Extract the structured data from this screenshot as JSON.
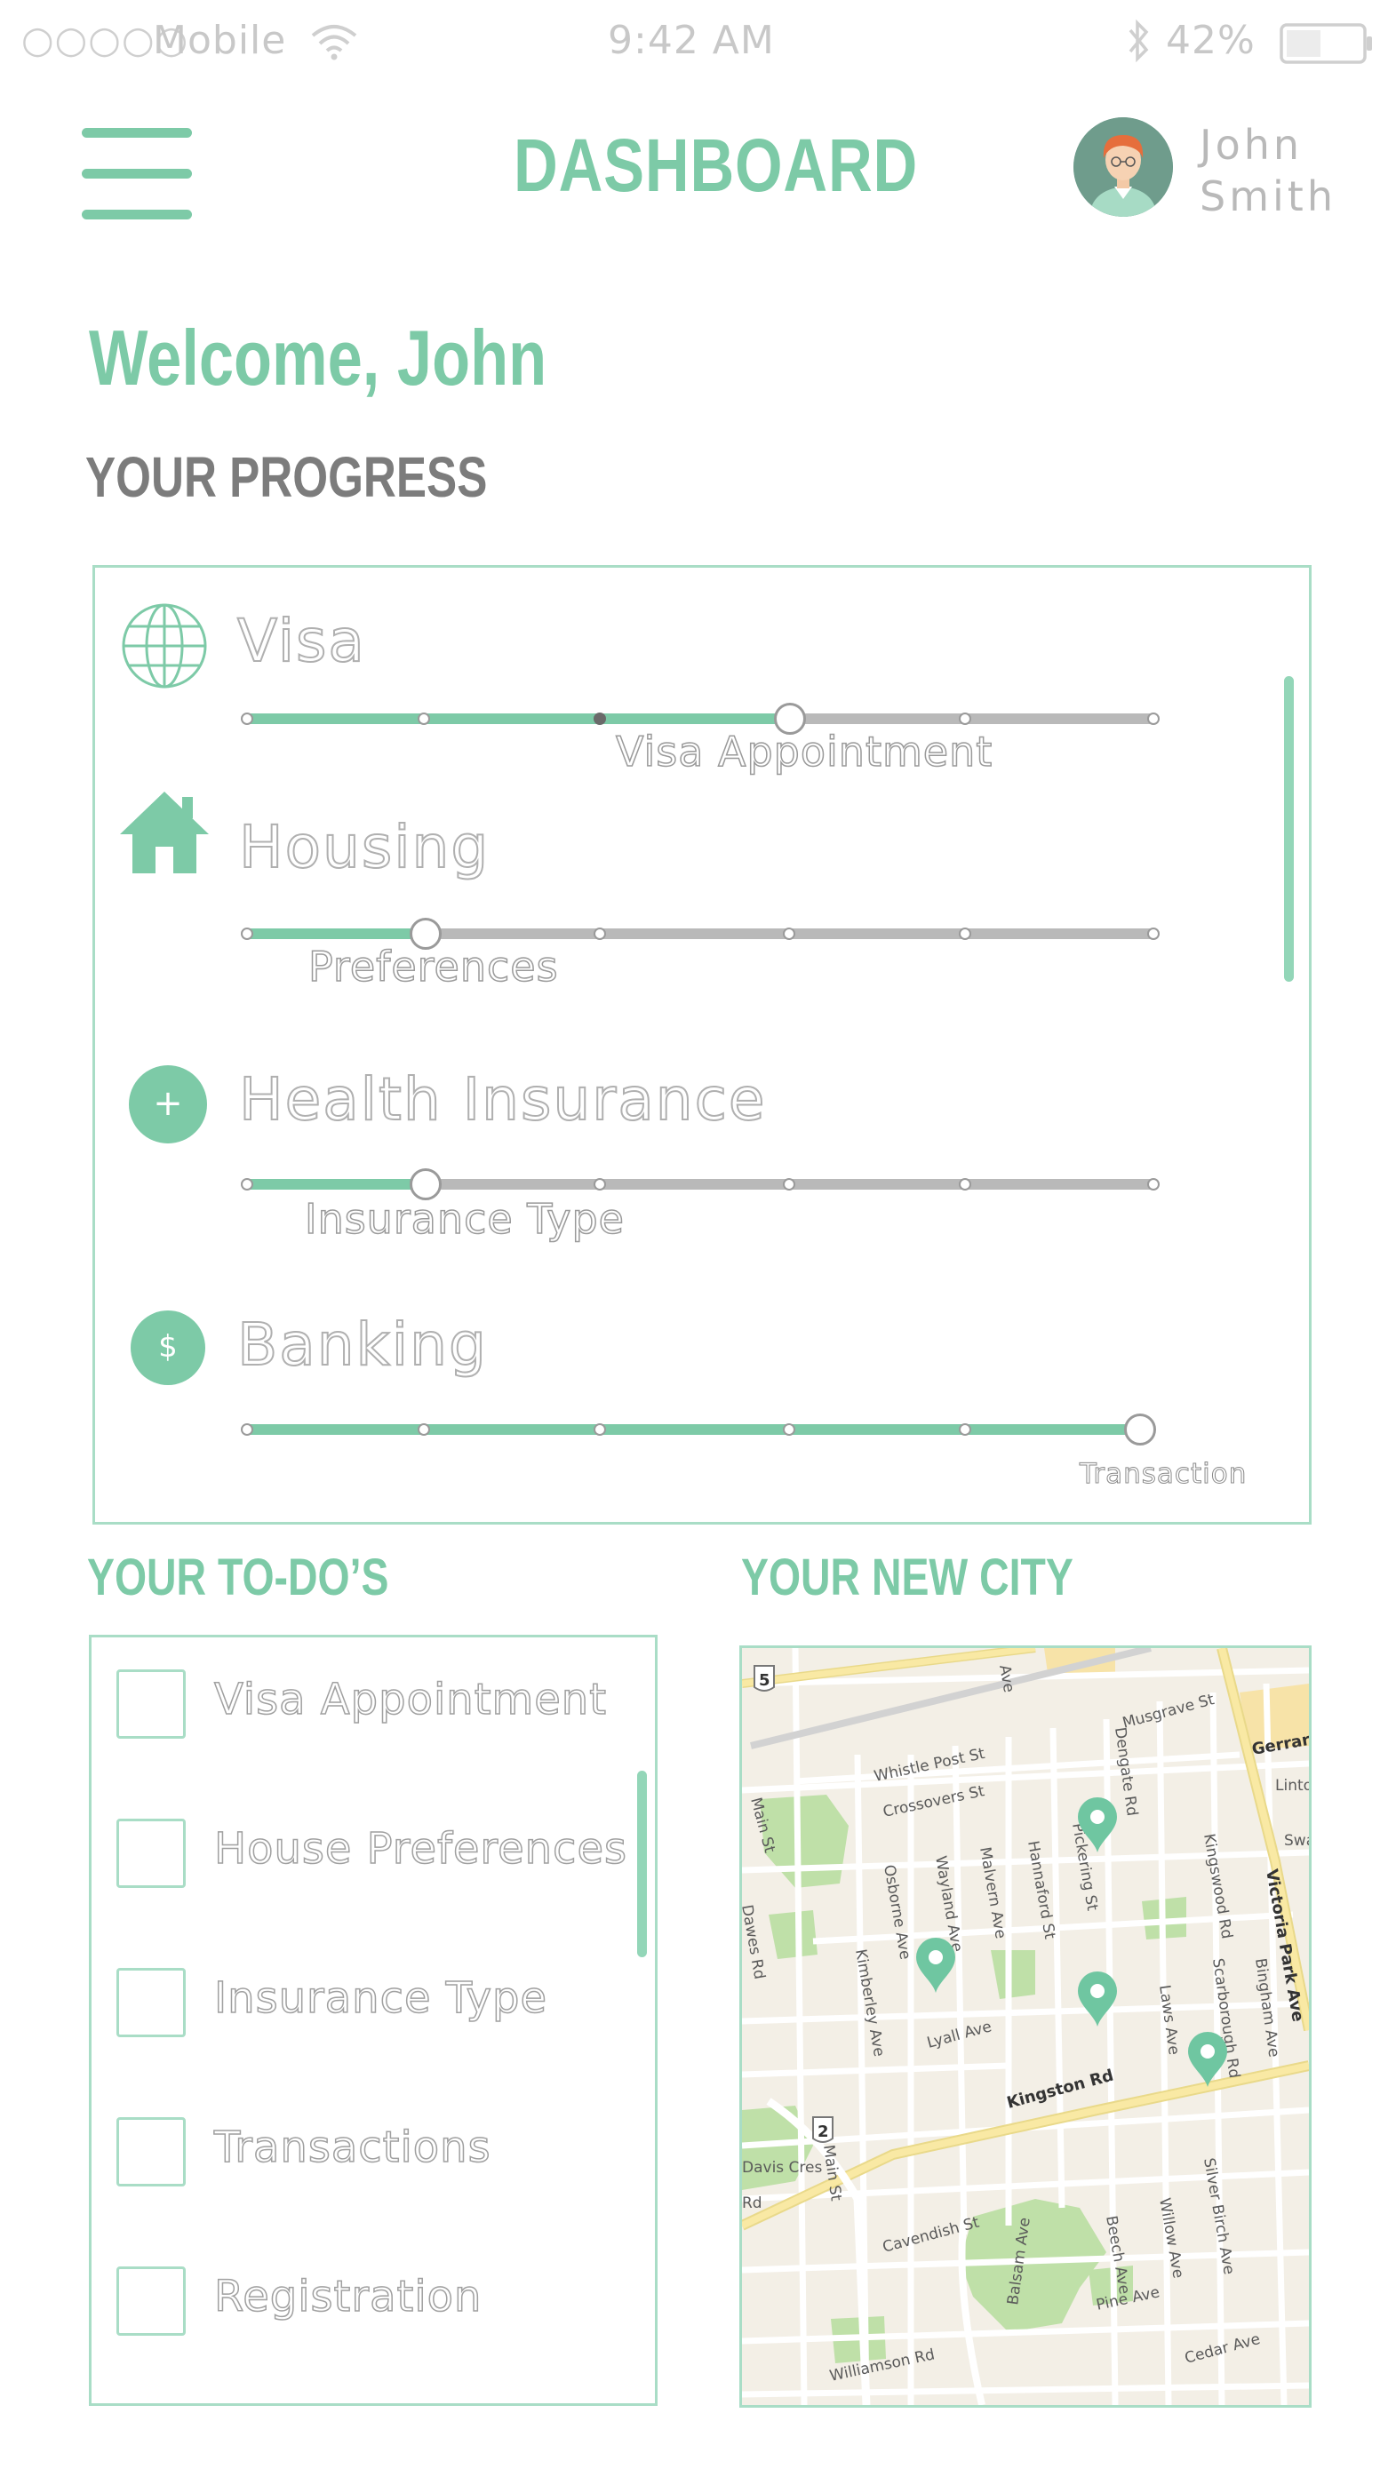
{
  "status_bar": {
    "signal": "○○○○○",
    "carrier": "Mobile",
    "time": "9:42 AM",
    "battery": "42%"
  },
  "header": {
    "title": "DASHBOARD",
    "user_first": "John",
    "user_last": "Smith"
  },
  "welcome": "Welcome, John",
  "progress": {
    "title": "YOUR PROGRESS",
    "categories": [
      {
        "label": "Visa",
        "icon": "globe-icon",
        "current_step": "Visa Appointment",
        "progress": 0.6,
        "steps": 6
      },
      {
        "label": "Housing",
        "icon": "house-icon",
        "current_step": "Preferences",
        "progress": 0.2,
        "steps": 6
      },
      {
        "label": "Health Insurance",
        "icon": "plus-icon",
        "icon_glyph": "+",
        "current_step": "Insurance Type",
        "progress": 0.2,
        "steps": 6
      },
      {
        "label": "Banking",
        "icon": "dollar-icon",
        "icon_glyph": "$",
        "current_step": "Transaction",
        "progress": 1.0,
        "steps": 6
      }
    ]
  },
  "todos": {
    "title": "YOUR TO-DO’S",
    "items": [
      {
        "label": "Visa Appointment",
        "checked": false
      },
      {
        "label": "House Preferences",
        "checked": false
      },
      {
        "label": "Insurance Type",
        "checked": false
      },
      {
        "label": "Transactions",
        "checked": false
      },
      {
        "label": "Registration",
        "checked": false
      }
    ]
  },
  "city": {
    "title": "YOUR NEW CITY",
    "streets": [
      "Musgrave St",
      "Gerrard",
      "Linton",
      "Swan",
      "Whistle Post St",
      "Crossovers St",
      "Main St",
      "Dawes Rd",
      "Osborne Ave",
      "Wayland Ave",
      "Malvern Ave",
      "Hannaford St",
      "Pickering St",
      "Dengate Rd",
      "Kingswood Rd",
      "Victoria Park Ave",
      "Lyall Ave",
      "Kimberley Ave",
      "Laws Ave",
      "Scarborough Rd",
      "Bingham Ave",
      "Kingston Rd",
      "Davis Cres",
      "Main St",
      "Rd",
      "Cavendish St",
      "Balsam Ave",
      "Beech Ave",
      "Willow Ave",
      "Silver Birch Ave",
      "Pine Ave",
      "Williamson Rd",
      "Cedar Ave",
      "Ave"
    ],
    "route_badges": [
      "5",
      "2"
    ],
    "colors": {
      "park": "#bfe0a8",
      "road": "#f9e9a4",
      "street": "#ffffff",
      "land": "#f3efe6",
      "pin": "#6fc6a1"
    }
  },
  "colors": {
    "accent": "#7dcaa7",
    "track_done": "#7dcaa7",
    "track_todo": "#b9b9b9",
    "border": "#a9ddc6"
  }
}
